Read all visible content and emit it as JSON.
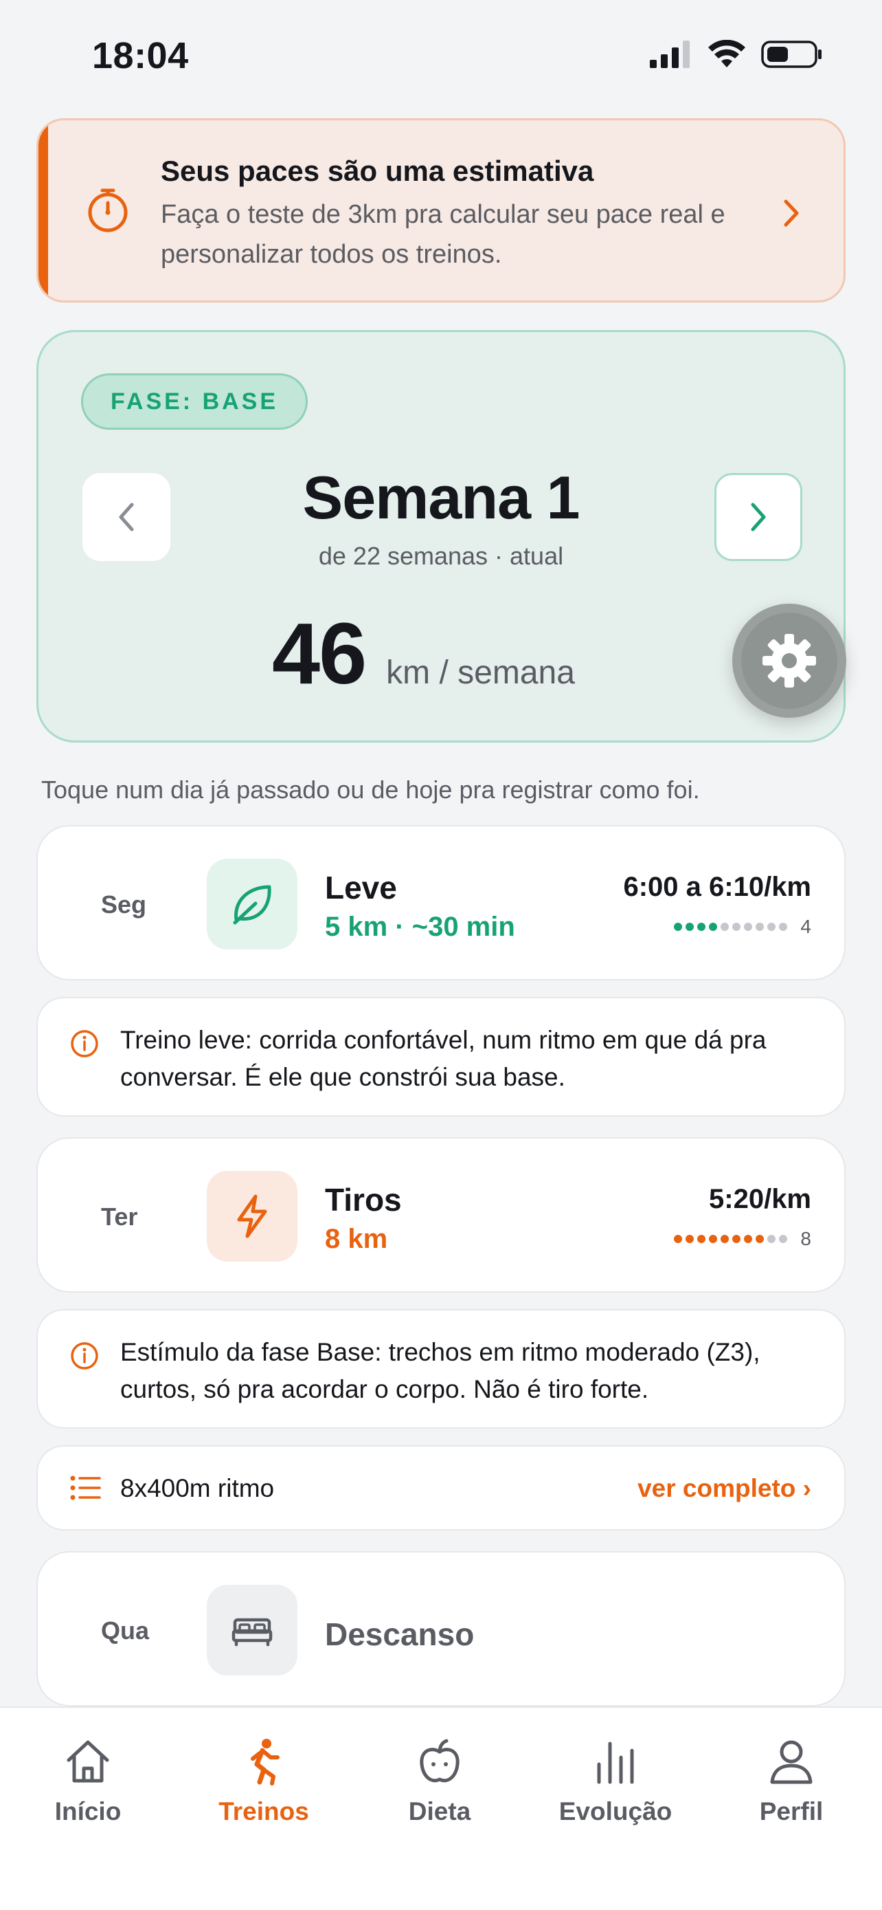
{
  "status_bar": {
    "time": "18:04"
  },
  "estimate_banner": {
    "title": "Seus paces são uma estimativa",
    "body": "Faça o teste de 3km pra calcular seu pace real e personalizar todos os treinos.",
    "icon": "stopwatch-icon"
  },
  "week": {
    "phase": "FASE: BASE",
    "title": "Semana 1",
    "subtitle": "de 22 semanas · atual",
    "km": "46",
    "km_unit": "km / semana"
  },
  "hint": "Toque num dia já passado ou de hoje pra registrar como foi.",
  "days": [
    {
      "day": "Seg",
      "name": "Leve",
      "meta": "5 km · ~30 min",
      "pace": "6:00 a 6:10/km",
      "intensity": 4,
      "intensity_max": 10,
      "icon": "leaf-icon",
      "color": "#17a276"
    },
    {
      "day": "Ter",
      "name": "Tiros",
      "meta": "8 km",
      "pace": "5:20/km",
      "intensity": 8,
      "intensity_max": 10,
      "icon": "lightning-icon",
      "color": "#e8620f"
    },
    {
      "day": "Qua",
      "name": "Descanso",
      "icon": "bed-icon"
    }
  ],
  "info": [
    {
      "text": "Treino leve: corrida confortável, num ritmo em que dá pra conversar. É ele que constrói sua base."
    },
    {
      "text": "Estímulo da fase Base: trechos em ritmo moderado (Z3), curtos, só pra acordar o corpo. Não é tiro forte."
    }
  ],
  "detail": {
    "text": "8x400m ritmo",
    "link": "ver completo ›"
  },
  "tabs": [
    {
      "label": "Início",
      "icon": "home-icon"
    },
    {
      "label": "Treinos",
      "icon": "runner-icon",
      "active": true
    },
    {
      "label": "Dieta",
      "icon": "apple-icon"
    },
    {
      "label": "Evolução",
      "icon": "bar-chart-icon"
    },
    {
      "label": "Perfil",
      "icon": "person-icon"
    }
  ],
  "colors": {
    "accent": "#e8620f",
    "green": "#17a276",
    "muted": "#5a5c63"
  }
}
